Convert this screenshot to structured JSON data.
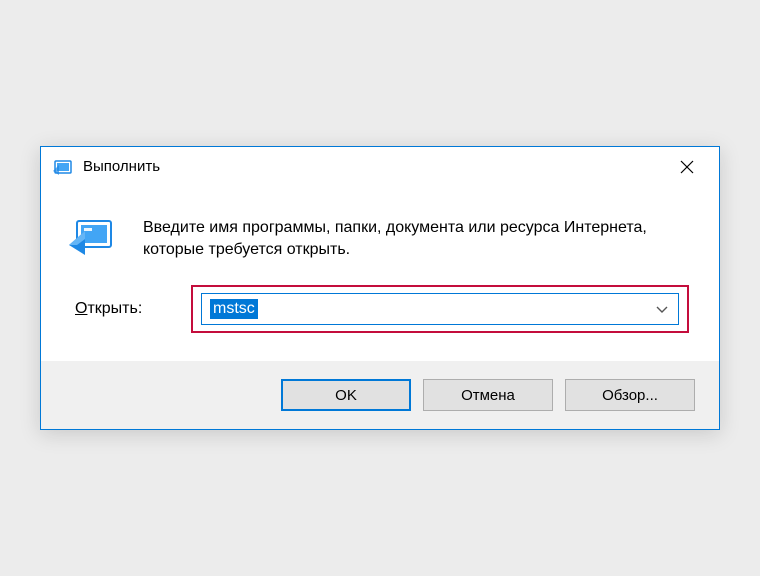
{
  "dialog": {
    "title": "Выполнить",
    "description": "Введите имя программы, папки, документа или ресурса Интернета, которые требуется открыть.",
    "input_label_prefix": "О",
    "input_label_rest": "ткрыть:",
    "input_value": "mstsc",
    "buttons": {
      "ok": "OK",
      "cancel": "Отмена",
      "browse": "Обзор..."
    }
  }
}
